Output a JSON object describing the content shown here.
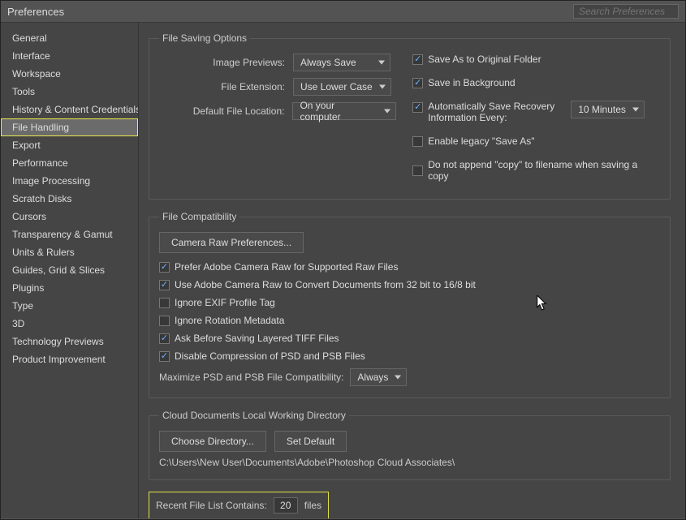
{
  "window": {
    "title": "Preferences",
    "search_placeholder": "Search Preferences"
  },
  "sidebar": {
    "items": [
      {
        "label": "General"
      },
      {
        "label": "Interface"
      },
      {
        "label": "Workspace"
      },
      {
        "label": "Tools"
      },
      {
        "label": "History & Content Credentials"
      },
      {
        "label": "File Handling"
      },
      {
        "label": "Export"
      },
      {
        "label": "Performance"
      },
      {
        "label": "Image Processing"
      },
      {
        "label": "Scratch Disks"
      },
      {
        "label": "Cursors"
      },
      {
        "label": "Transparency & Gamut"
      },
      {
        "label": "Units & Rulers"
      },
      {
        "label": "Guides, Grid & Slices"
      },
      {
        "label": "Plugins"
      },
      {
        "label": "Type"
      },
      {
        "label": "3D"
      },
      {
        "label": "Technology Previews"
      },
      {
        "label": "Product Improvement"
      }
    ]
  },
  "file_saving": {
    "legend": "File Saving Options",
    "image_previews_label": "Image Previews:",
    "image_previews_value": "Always Save",
    "file_ext_label": "File Extension:",
    "file_ext_value": "Use Lower Case",
    "default_loc_label": "Default File Location:",
    "default_loc_value": "On your computer",
    "save_as_orig": "Save As to Original Folder",
    "save_bg": "Save in Background",
    "auto_save": "Automatically Save Recovery Information Every:",
    "auto_save_value": "10 Minutes",
    "legacy": "Enable legacy \"Save As\"",
    "no_copy": "Do not append \"copy\" to filename when saving a copy"
  },
  "compat": {
    "legend": "File Compatibility",
    "camera_raw_btn": "Camera Raw Preferences...",
    "prefer_acr": "Prefer Adobe Camera Raw for Supported Raw Files",
    "use_acr_32": "Use Adobe Camera Raw to Convert Documents from 32 bit to 16/8 bit",
    "ignore_exif": "Ignore EXIF Profile Tag",
    "ignore_rot": "Ignore Rotation Metadata",
    "ask_tiff": "Ask Before Saving Layered TIFF Files",
    "disable_psd": "Disable Compression of PSD and PSB Files",
    "max_label": "Maximize PSD and PSB File Compatibility:",
    "max_value": "Always"
  },
  "cloud": {
    "legend": "Cloud Documents Local Working Directory",
    "choose_btn": "Choose Directory...",
    "default_btn": "Set Default",
    "path": "C:\\Users\\New User\\Documents\\Adobe\\Photoshop Cloud Associates\\"
  },
  "recent": {
    "label": "Recent File List Contains:",
    "value": "20",
    "suffix": "files"
  }
}
